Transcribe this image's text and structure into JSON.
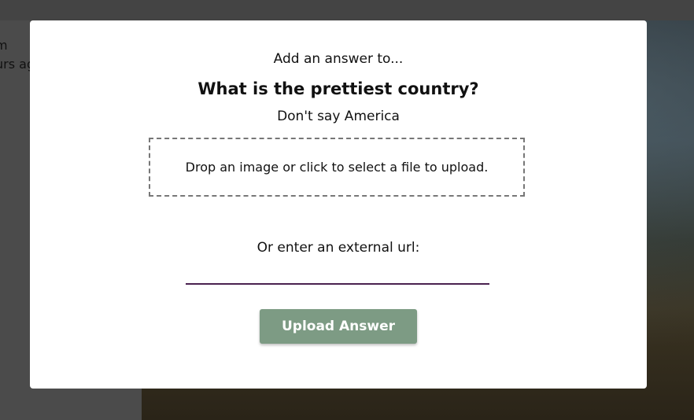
{
  "background": {
    "partial_text_lines": [
      "m",
      "urs ag"
    ]
  },
  "modal": {
    "prompt": "Add an answer to...",
    "question": "What is the prettiest country?",
    "description": "Don't say America",
    "dropzone_text": "Drop an image or click to select a file to upload.",
    "url_label": "Or enter an external url:",
    "url_value": "",
    "upload_button_label": "Upload Answer"
  },
  "colors": {
    "button_background": "#7d9b84",
    "input_underline": "#4a2150",
    "overlay": "#4a4a4a"
  }
}
